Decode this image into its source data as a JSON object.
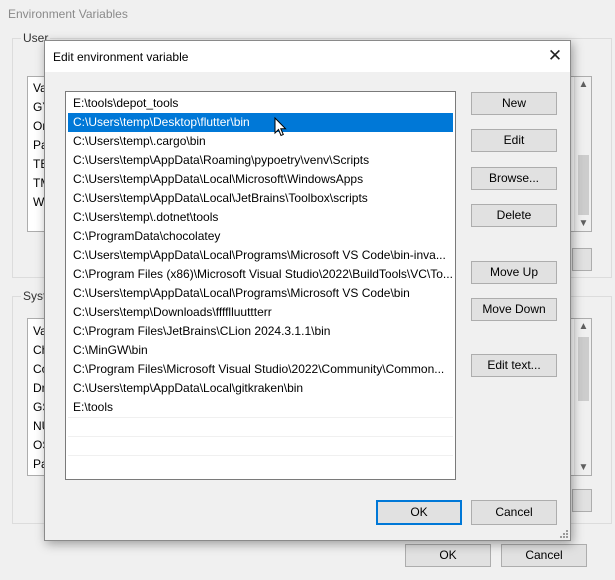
{
  "background_window": {
    "title": "Environment Variables",
    "user_group_label": "User",
    "user_list_rows": [
      "Va",
      "GY",
      "Or",
      "Pa",
      "TE",
      "TM",
      "W"
    ],
    "system_group_label": "Syste",
    "system_list_rows": [
      "Va",
      "Ch",
      "Co",
      "Dr",
      "GS",
      "NU",
      "OS",
      "Pa"
    ],
    "ok_label": "OK",
    "cancel_label": "Cancel"
  },
  "dialog": {
    "title": "Edit environment variable",
    "close_glyph": "✕",
    "paths": [
      "E:\\tools\\depot_tools",
      "C:\\Users\\temp\\Desktop\\flutter\\bin",
      "C:\\Users\\temp\\.cargo\\bin",
      "C:\\Users\\temp\\AppData\\Roaming\\pypoetry\\venv\\Scripts",
      "C:\\Users\\temp\\AppData\\Local\\Microsoft\\WindowsApps",
      "C:\\Users\\temp\\AppData\\Local\\JetBrains\\Toolbox\\scripts",
      "C:\\Users\\temp\\.dotnet\\tools",
      "C:\\ProgramData\\chocolatey",
      "C:\\Users\\temp\\AppData\\Local\\Programs\\Microsoft VS Code\\bin-inva...",
      "C:\\Program Files (x86)\\Microsoft Visual Studio\\2022\\BuildTools\\VC\\To...",
      "C:\\Users\\temp\\AppData\\Local\\Programs\\Microsoft VS Code\\bin",
      "C:\\Users\\temp\\Downloads\\fffflluuttterr",
      "C:\\Program Files\\JetBrains\\CLion 2024.3.1.1\\bin",
      "C:\\MinGW\\bin",
      "C:\\Program Files\\Microsoft Visual Studio\\2022\\Community\\Common...",
      "C:\\Users\\temp\\AppData\\Local\\gitkraken\\bin",
      "E:\\tools"
    ],
    "selected_index": 1,
    "buttons": {
      "new": "New",
      "edit": "Edit",
      "browse": "Browse...",
      "delete": "Delete",
      "move_up": "Move Up",
      "move_down": "Move Down",
      "edit_text": "Edit text..."
    },
    "ok_label": "OK",
    "cancel_label": "Cancel"
  },
  "colors": {
    "selection": "#0078d7",
    "window_bg": "#f0f0f0"
  }
}
